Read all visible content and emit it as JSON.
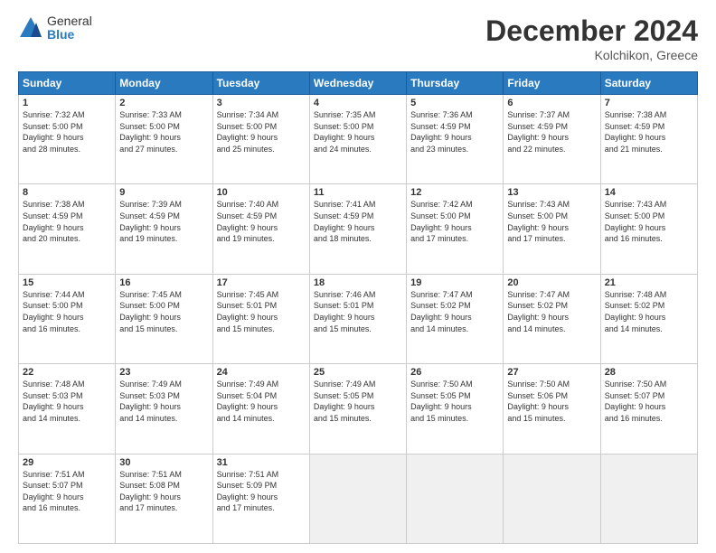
{
  "logo": {
    "general": "General",
    "blue": "Blue"
  },
  "header": {
    "month": "December 2024",
    "location": "Kolchikon, Greece"
  },
  "weekdays": [
    "Sunday",
    "Monday",
    "Tuesday",
    "Wednesday",
    "Thursday",
    "Friday",
    "Saturday"
  ],
  "weeks": [
    [
      {
        "day": "1",
        "info": "Sunrise: 7:32 AM\nSunset: 5:00 PM\nDaylight: 9 hours\nand 28 minutes."
      },
      {
        "day": "2",
        "info": "Sunrise: 7:33 AM\nSunset: 5:00 PM\nDaylight: 9 hours\nand 27 minutes."
      },
      {
        "day": "3",
        "info": "Sunrise: 7:34 AM\nSunset: 5:00 PM\nDaylight: 9 hours\nand 25 minutes."
      },
      {
        "day": "4",
        "info": "Sunrise: 7:35 AM\nSunset: 5:00 PM\nDaylight: 9 hours\nand 24 minutes."
      },
      {
        "day": "5",
        "info": "Sunrise: 7:36 AM\nSunset: 4:59 PM\nDaylight: 9 hours\nand 23 minutes."
      },
      {
        "day": "6",
        "info": "Sunrise: 7:37 AM\nSunset: 4:59 PM\nDaylight: 9 hours\nand 22 minutes."
      },
      {
        "day": "7",
        "info": "Sunrise: 7:38 AM\nSunset: 4:59 PM\nDaylight: 9 hours\nand 21 minutes."
      }
    ],
    [
      {
        "day": "8",
        "info": "Sunrise: 7:38 AM\nSunset: 4:59 PM\nDaylight: 9 hours\nand 20 minutes."
      },
      {
        "day": "9",
        "info": "Sunrise: 7:39 AM\nSunset: 4:59 PM\nDaylight: 9 hours\nand 19 minutes."
      },
      {
        "day": "10",
        "info": "Sunrise: 7:40 AM\nSunset: 4:59 PM\nDaylight: 9 hours\nand 19 minutes."
      },
      {
        "day": "11",
        "info": "Sunrise: 7:41 AM\nSunset: 4:59 PM\nDaylight: 9 hours\nand 18 minutes."
      },
      {
        "day": "12",
        "info": "Sunrise: 7:42 AM\nSunset: 5:00 PM\nDaylight: 9 hours\nand 17 minutes."
      },
      {
        "day": "13",
        "info": "Sunrise: 7:43 AM\nSunset: 5:00 PM\nDaylight: 9 hours\nand 17 minutes."
      },
      {
        "day": "14",
        "info": "Sunrise: 7:43 AM\nSunset: 5:00 PM\nDaylight: 9 hours\nand 16 minutes."
      }
    ],
    [
      {
        "day": "15",
        "info": "Sunrise: 7:44 AM\nSunset: 5:00 PM\nDaylight: 9 hours\nand 16 minutes."
      },
      {
        "day": "16",
        "info": "Sunrise: 7:45 AM\nSunset: 5:00 PM\nDaylight: 9 hours\nand 15 minutes."
      },
      {
        "day": "17",
        "info": "Sunrise: 7:45 AM\nSunset: 5:01 PM\nDaylight: 9 hours\nand 15 minutes."
      },
      {
        "day": "18",
        "info": "Sunrise: 7:46 AM\nSunset: 5:01 PM\nDaylight: 9 hours\nand 15 minutes."
      },
      {
        "day": "19",
        "info": "Sunrise: 7:47 AM\nSunset: 5:02 PM\nDaylight: 9 hours\nand 14 minutes."
      },
      {
        "day": "20",
        "info": "Sunrise: 7:47 AM\nSunset: 5:02 PM\nDaylight: 9 hours\nand 14 minutes."
      },
      {
        "day": "21",
        "info": "Sunrise: 7:48 AM\nSunset: 5:02 PM\nDaylight: 9 hours\nand 14 minutes."
      }
    ],
    [
      {
        "day": "22",
        "info": "Sunrise: 7:48 AM\nSunset: 5:03 PM\nDaylight: 9 hours\nand 14 minutes."
      },
      {
        "day": "23",
        "info": "Sunrise: 7:49 AM\nSunset: 5:03 PM\nDaylight: 9 hours\nand 14 minutes."
      },
      {
        "day": "24",
        "info": "Sunrise: 7:49 AM\nSunset: 5:04 PM\nDaylight: 9 hours\nand 14 minutes."
      },
      {
        "day": "25",
        "info": "Sunrise: 7:49 AM\nSunset: 5:05 PM\nDaylight: 9 hours\nand 15 minutes."
      },
      {
        "day": "26",
        "info": "Sunrise: 7:50 AM\nSunset: 5:05 PM\nDaylight: 9 hours\nand 15 minutes."
      },
      {
        "day": "27",
        "info": "Sunrise: 7:50 AM\nSunset: 5:06 PM\nDaylight: 9 hours\nand 15 minutes."
      },
      {
        "day": "28",
        "info": "Sunrise: 7:50 AM\nSunset: 5:07 PM\nDaylight: 9 hours\nand 16 minutes."
      }
    ],
    [
      {
        "day": "29",
        "info": "Sunrise: 7:51 AM\nSunset: 5:07 PM\nDaylight: 9 hours\nand 16 minutes."
      },
      {
        "day": "30",
        "info": "Sunrise: 7:51 AM\nSunset: 5:08 PM\nDaylight: 9 hours\nand 17 minutes."
      },
      {
        "day": "31",
        "info": "Sunrise: 7:51 AM\nSunset: 5:09 PM\nDaylight: 9 hours\nand 17 minutes."
      },
      null,
      null,
      null,
      null
    ]
  ]
}
